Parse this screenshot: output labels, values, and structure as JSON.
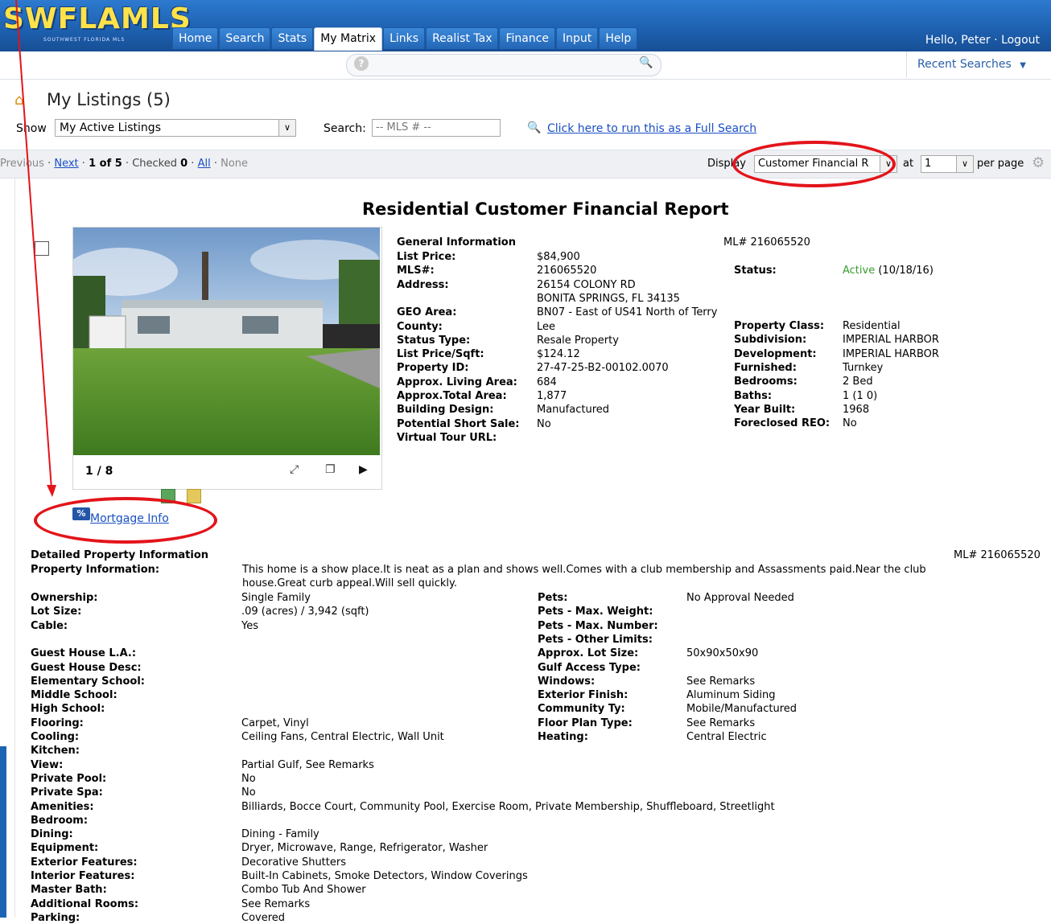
{
  "header": {
    "logo_text": "SWFLAMLS",
    "logo_sub": "SOUTHWEST FLORIDA MLS",
    "nav": [
      {
        "label": "Home"
      },
      {
        "label": "Search"
      },
      {
        "label": "Stats"
      },
      {
        "label": "My Matrix"
      },
      {
        "label": "Links"
      },
      {
        "label": "Realist Tax"
      },
      {
        "label": "Finance"
      },
      {
        "label": "Input"
      },
      {
        "label": "Help"
      }
    ],
    "active_tab": "My Matrix",
    "greeting": "Hello, Peter",
    "logout": "Logout",
    "recent_searches": "Recent Searches"
  },
  "page": {
    "title": "My Listings (5)",
    "show_label": "Show",
    "show_value": "My Active Listings",
    "search_label": "Search:",
    "search_placeholder": "-- MLS # --",
    "full_search_link": "Click here to run this as a Full Search"
  },
  "pager": {
    "previous": "Previous",
    "next": "Next",
    "position": "1 of 5",
    "checked_label": "Checked",
    "checked_count": "0",
    "all": "All",
    "none": "None",
    "display_label": "Display",
    "display_value": "Customer Financial R",
    "at_label": "at",
    "per_page_value": "1",
    "per_page_label": "per page"
  },
  "report": {
    "title": "Residential Customer Financial Report",
    "photo_counter": "1 / 8",
    "mortgage_link": "Mortgage Info",
    "general": {
      "heading": "General Information",
      "ml_number": "ML# 216065520",
      "left": [
        {
          "label": "List Price:",
          "value": "$84,900"
        },
        {
          "label": "MLS#:",
          "value": "216065520"
        },
        {
          "label": "Address:",
          "value": "26154 COLONY RD"
        },
        {
          "label": "",
          "value": "BONITA SPRINGS, FL 34135"
        },
        {
          "label": "GEO Area:",
          "value": "BN07 - East of US41 North of Terry"
        },
        {
          "label": "County:",
          "value": "Lee"
        },
        {
          "label": "Status Type:",
          "value": "Resale Property"
        },
        {
          "label": "List Price/Sqft:",
          "value": "$124.12"
        },
        {
          "label": "Property ID:",
          "value": "27-47-25-B2-00102.0070"
        },
        {
          "label": "Approx. Living Area:",
          "value": "684"
        },
        {
          "label": "Approx.Total Area:",
          "value": "1,877"
        },
        {
          "label": "Building Design:",
          "value": "Manufactured"
        },
        {
          "label": "Potential Short Sale:",
          "value": "No"
        },
        {
          "label": "Virtual Tour URL:",
          "value": ""
        }
      ],
      "status_label": "Status:",
      "status_value": "Active",
      "status_date": "(10/18/16)",
      "right": [
        {
          "label": "Property Class:",
          "value": "Residential"
        },
        {
          "label": "Subdivision:",
          "value": "IMPERIAL HARBOR"
        },
        {
          "label": "Development:",
          "value": "IMPERIAL HARBOR"
        },
        {
          "label": "Furnished:",
          "value": "Turnkey"
        },
        {
          "label": "Bedrooms:",
          "value": "2 Bed"
        },
        {
          "label": "Baths:",
          "value": "1 (1 0)"
        },
        {
          "label": "Year Built:",
          "value": "1968"
        },
        {
          "label": "Foreclosed REO:",
          "value": "No"
        }
      ]
    },
    "detailed": {
      "heading": "Detailed Property Information",
      "ml_number": "ML# 216065520",
      "property_info_label": "Property Information:",
      "property_info_line1": "This home is a show place.It is neat as a plan and shows well.Comes with a club membership and Assassments paid.Near the club",
      "property_info_line2": "house.Great curb appeal.Will sell quickly.",
      "left": [
        {
          "label": "Ownership:",
          "value": "Single Family"
        },
        {
          "label": "Lot Size:",
          "value": ".09 (acres) / 3,942 (sqft)"
        },
        {
          "label": "Cable:",
          "value": "Yes"
        },
        {
          "label": "",
          "value": ""
        },
        {
          "label": "Guest House L.A.:",
          "value": ""
        },
        {
          "label": "Guest House Desc:",
          "value": ""
        },
        {
          "label": "Elementary School:",
          "value": ""
        },
        {
          "label": "Middle School:",
          "value": ""
        },
        {
          "label": "High School:",
          "value": ""
        },
        {
          "label": "Flooring:",
          "value": "Carpet, Vinyl"
        },
        {
          "label": "Cooling:",
          "value": "Ceiling Fans, Central Electric, Wall Unit"
        },
        {
          "label": "Kitchen:",
          "value": ""
        },
        {
          "label": "View:",
          "value": "Partial Gulf, See Remarks"
        },
        {
          "label": "Private Pool:",
          "value": "No"
        },
        {
          "label": "Private Spa:",
          "value": "No"
        },
        {
          "label": "Amenities:",
          "value": "Billiards, Bocce Court, Community Pool, Exercise Room, Private Membership, Shuffleboard, Streetlight"
        },
        {
          "label": "Bedroom:",
          "value": ""
        },
        {
          "label": "Dining:",
          "value": "Dining - Family"
        },
        {
          "label": "Equipment:",
          "value": "Dryer, Microwave, Range, Refrigerator, Washer"
        },
        {
          "label": "Exterior Features:",
          "value": "Decorative Shutters"
        },
        {
          "label": "Interior Features:",
          "value": "Built-In Cabinets, Smoke Detectors, Window Coverings"
        },
        {
          "label": "Master Bath:",
          "value": "Combo Tub And Shower"
        },
        {
          "label": "Additional Rooms:",
          "value": "See Remarks"
        },
        {
          "label": "Parking:",
          "value": "Covered"
        }
      ],
      "right": [
        {
          "label": "Pets:",
          "value": "No Approval Needed"
        },
        {
          "label": "Pets - Max. Weight:",
          "value": ""
        },
        {
          "label": "Pets - Max. Number:",
          "value": ""
        },
        {
          "label": "Pets - Other Limits:",
          "value": ""
        },
        {
          "label": "Approx. Lot Size:",
          "value": "50x90x50x90"
        },
        {
          "label": "Gulf Access Type:",
          "value": ""
        },
        {
          "label": "Windows:",
          "value": "See Remarks"
        },
        {
          "label": "Exterior Finish:",
          "value": "Aluminum Siding"
        },
        {
          "label": "Community Ty:",
          "value": "Mobile/Manufactured"
        },
        {
          "label": "Floor Plan Type:",
          "value": "See Remarks"
        },
        {
          "label": "Heating:",
          "value": "Central Electric"
        }
      ]
    }
  },
  "colors": {
    "header_blue": "#1d5fae",
    "link_blue": "#1a4fc4",
    "status_green": "#3a9a2e",
    "annotation_red": "#e3141a"
  }
}
